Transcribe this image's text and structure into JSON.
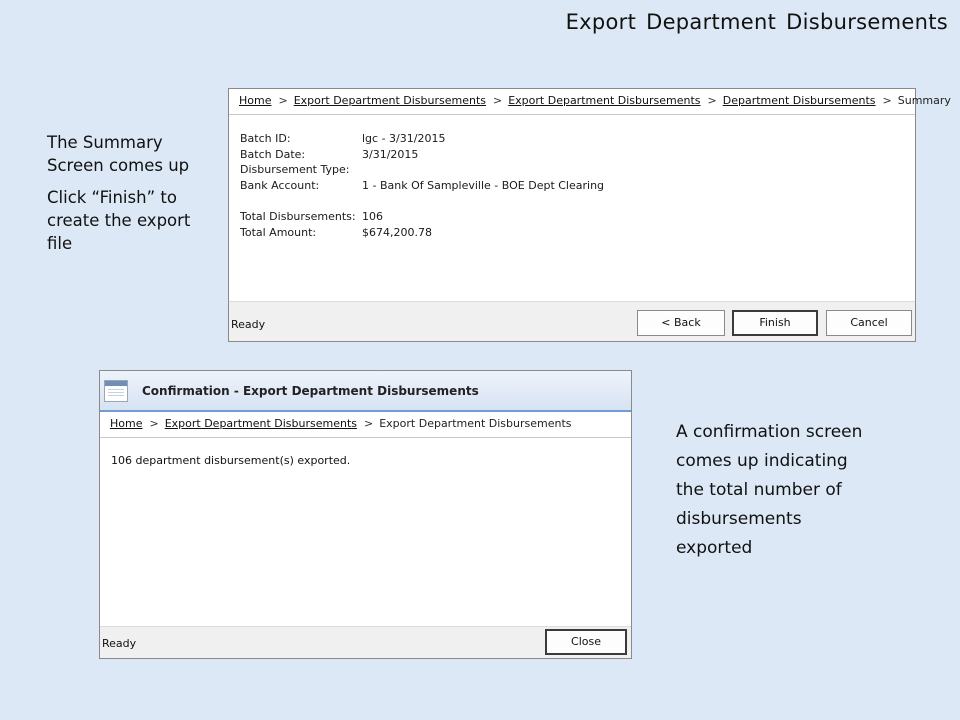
{
  "slide": {
    "title": "Export Department Disbursements",
    "note1": {
      "line1": "The Summary Screen comes up",
      "line2": "Click “Finish” to create the export file"
    },
    "note2": "A confirmation screen comes up indicating the total number of disbursements exported"
  },
  "summary_window": {
    "breadcrumb": [
      "Home",
      "Export Department Disbursements",
      "Export Department Disbursements",
      "Department Disbursements",
      "Summary"
    ],
    "fields": {
      "batch_id_label": "Batch ID:",
      "batch_id_value": "lgc - 3/31/2015",
      "batch_date_label": "Batch Date:",
      "batch_date_value": "3/31/2015",
      "disb_type_label": "Disbursement Type:",
      "disb_type_value": "",
      "bank_label": "Bank Account:",
      "bank_value": "1 - Bank Of Sampleville - BOE Dept Clearing",
      "total_disb_label": "Total Disbursements:",
      "total_disb_value": "106",
      "total_amount_label": "Total Amount:",
      "total_amount_value": "$674,200.78"
    },
    "status": "Ready",
    "buttons": {
      "back": "< Back",
      "finish": "Finish",
      "cancel": "Cancel"
    }
  },
  "confirmation_window": {
    "title": "Confirmation - Export Department Disbursements",
    "breadcrumb": [
      "Home",
      "Export Department Disbursements",
      "Export Department Disbursements"
    ],
    "message": "106 department disbursement(s) exported.",
    "status": "Ready",
    "close": "Close"
  }
}
